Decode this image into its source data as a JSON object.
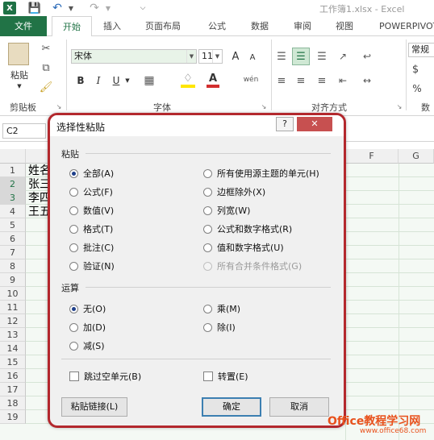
{
  "window": {
    "app_icon": "X",
    "doc_title": "工作簿1.xlsx - Excel"
  },
  "quick_access": {
    "icons": [
      "excel-logo",
      "save-icon",
      "undo-icon",
      "redo-icon",
      "customize-icon"
    ]
  },
  "tabs": [
    {
      "label": "文件"
    },
    {
      "label": "开始"
    },
    {
      "label": "插入"
    },
    {
      "label": "页面布局"
    },
    {
      "label": "公式"
    },
    {
      "label": "数据"
    },
    {
      "label": "审阅"
    },
    {
      "label": "视图"
    },
    {
      "label": "POWERPIVOT"
    }
  ],
  "ribbon": {
    "paste_label": "粘贴",
    "clipboard_label": "剪贴板",
    "font_name": "宋体",
    "font_size": "11",
    "font_group_label": "字体",
    "bold": "B",
    "italic": "I",
    "underline": "U",
    "wen_label": "wén",
    "grow_font": "A",
    "shrink_font": "A",
    "align_group_label": "对齐方式",
    "number_format": "常规",
    "currency": "$",
    "number_group_label": "数",
    "font_color": "#d32f2f",
    "fill_color": "#ffe600",
    "accent": "#217346"
  },
  "formula_bar": {
    "name_box": "C2"
  },
  "grid": {
    "columns": [
      "F",
      "G"
    ],
    "rows": [
      "1",
      "2",
      "3",
      "4",
      "5",
      "6",
      "7",
      "8",
      "9",
      "10",
      "11",
      "12",
      "13",
      "14",
      "15",
      "16",
      "17",
      "18",
      "19"
    ],
    "cells": [
      "姓名",
      "张三",
      "李四",
      "王五"
    ]
  },
  "dialog": {
    "title": "选择性粘贴",
    "help": "?",
    "close": "✕",
    "paste_section": "粘贴",
    "paste_options_left": [
      {
        "label": "全部(A)",
        "checked": true
      },
      {
        "label": "公式(F)"
      },
      {
        "label": "数值(V)"
      },
      {
        "label": "格式(T)"
      },
      {
        "label": "批注(C)"
      },
      {
        "label": "验证(N)"
      }
    ],
    "paste_options_right": [
      {
        "label": "所有使用源主题的单元(H)"
      },
      {
        "label": "边框除外(X)"
      },
      {
        "label": "列宽(W)"
      },
      {
        "label": "公式和数字格式(R)"
      },
      {
        "label": "值和数字格式(U)"
      },
      {
        "label": "所有合并条件格式(G)",
        "disabled": true
      }
    ],
    "op_section": "运算",
    "op_left": [
      {
        "label": "无(O)",
        "checked": true
      },
      {
        "label": "加(D)"
      },
      {
        "label": "减(S)"
      }
    ],
    "op_right": [
      {
        "label": "乘(M)"
      },
      {
        "label": "除(I)"
      }
    ],
    "skip_blanks": "跳过空单元(B)",
    "transpose": "转置(E)",
    "paste_link": "粘贴链接(L)",
    "ok": "确定",
    "cancel": "取消"
  },
  "watermark": {
    "line1": "Office教程学习网",
    "line2": "www.office68.com"
  }
}
